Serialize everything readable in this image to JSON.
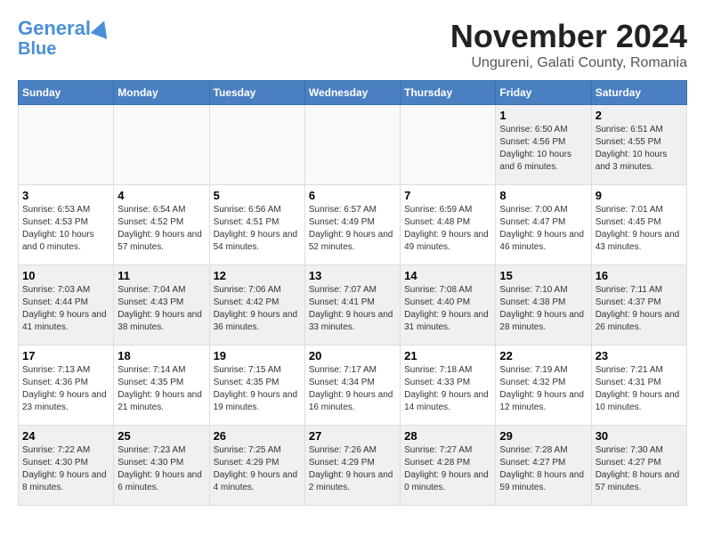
{
  "logo": {
    "line1": "General",
    "line2": "Blue"
  },
  "title": "November 2024",
  "subtitle": "Ungureni, Galati County, Romania",
  "weekdays": [
    "Sunday",
    "Monday",
    "Tuesday",
    "Wednesday",
    "Thursday",
    "Friday",
    "Saturday"
  ],
  "rows": [
    [
      {
        "day": "",
        "info": ""
      },
      {
        "day": "",
        "info": ""
      },
      {
        "day": "",
        "info": ""
      },
      {
        "day": "",
        "info": ""
      },
      {
        "day": "",
        "info": ""
      },
      {
        "day": "1",
        "info": "Sunrise: 6:50 AM\nSunset: 4:56 PM\nDaylight: 10 hours and 6 minutes."
      },
      {
        "day": "2",
        "info": "Sunrise: 6:51 AM\nSunset: 4:55 PM\nDaylight: 10 hours and 3 minutes."
      }
    ],
    [
      {
        "day": "3",
        "info": "Sunrise: 6:53 AM\nSunset: 4:53 PM\nDaylight: 10 hours and 0 minutes."
      },
      {
        "day": "4",
        "info": "Sunrise: 6:54 AM\nSunset: 4:52 PM\nDaylight: 9 hours and 57 minutes."
      },
      {
        "day": "5",
        "info": "Sunrise: 6:56 AM\nSunset: 4:51 PM\nDaylight: 9 hours and 54 minutes."
      },
      {
        "day": "6",
        "info": "Sunrise: 6:57 AM\nSunset: 4:49 PM\nDaylight: 9 hours and 52 minutes."
      },
      {
        "day": "7",
        "info": "Sunrise: 6:59 AM\nSunset: 4:48 PM\nDaylight: 9 hours and 49 minutes."
      },
      {
        "day": "8",
        "info": "Sunrise: 7:00 AM\nSunset: 4:47 PM\nDaylight: 9 hours and 46 minutes."
      },
      {
        "day": "9",
        "info": "Sunrise: 7:01 AM\nSunset: 4:45 PM\nDaylight: 9 hours and 43 minutes."
      }
    ],
    [
      {
        "day": "10",
        "info": "Sunrise: 7:03 AM\nSunset: 4:44 PM\nDaylight: 9 hours and 41 minutes."
      },
      {
        "day": "11",
        "info": "Sunrise: 7:04 AM\nSunset: 4:43 PM\nDaylight: 9 hours and 38 minutes."
      },
      {
        "day": "12",
        "info": "Sunrise: 7:06 AM\nSunset: 4:42 PM\nDaylight: 9 hours and 36 minutes."
      },
      {
        "day": "13",
        "info": "Sunrise: 7:07 AM\nSunset: 4:41 PM\nDaylight: 9 hours and 33 minutes."
      },
      {
        "day": "14",
        "info": "Sunrise: 7:08 AM\nSunset: 4:40 PM\nDaylight: 9 hours and 31 minutes."
      },
      {
        "day": "15",
        "info": "Sunrise: 7:10 AM\nSunset: 4:38 PM\nDaylight: 9 hours and 28 minutes."
      },
      {
        "day": "16",
        "info": "Sunrise: 7:11 AM\nSunset: 4:37 PM\nDaylight: 9 hours and 26 minutes."
      }
    ],
    [
      {
        "day": "17",
        "info": "Sunrise: 7:13 AM\nSunset: 4:36 PM\nDaylight: 9 hours and 23 minutes."
      },
      {
        "day": "18",
        "info": "Sunrise: 7:14 AM\nSunset: 4:35 PM\nDaylight: 9 hours and 21 minutes."
      },
      {
        "day": "19",
        "info": "Sunrise: 7:15 AM\nSunset: 4:35 PM\nDaylight: 9 hours and 19 minutes."
      },
      {
        "day": "20",
        "info": "Sunrise: 7:17 AM\nSunset: 4:34 PM\nDaylight: 9 hours and 16 minutes."
      },
      {
        "day": "21",
        "info": "Sunrise: 7:18 AM\nSunset: 4:33 PM\nDaylight: 9 hours and 14 minutes."
      },
      {
        "day": "22",
        "info": "Sunrise: 7:19 AM\nSunset: 4:32 PM\nDaylight: 9 hours and 12 minutes."
      },
      {
        "day": "23",
        "info": "Sunrise: 7:21 AM\nSunset: 4:31 PM\nDaylight: 9 hours and 10 minutes."
      }
    ],
    [
      {
        "day": "24",
        "info": "Sunrise: 7:22 AM\nSunset: 4:30 PM\nDaylight: 9 hours and 8 minutes."
      },
      {
        "day": "25",
        "info": "Sunrise: 7:23 AM\nSunset: 4:30 PM\nDaylight: 9 hours and 6 minutes."
      },
      {
        "day": "26",
        "info": "Sunrise: 7:25 AM\nSunset: 4:29 PM\nDaylight: 9 hours and 4 minutes."
      },
      {
        "day": "27",
        "info": "Sunrise: 7:26 AM\nSunset: 4:29 PM\nDaylight: 9 hours and 2 minutes."
      },
      {
        "day": "28",
        "info": "Sunrise: 7:27 AM\nSunset: 4:28 PM\nDaylight: 9 hours and 0 minutes."
      },
      {
        "day": "29",
        "info": "Sunrise: 7:28 AM\nSunset: 4:27 PM\nDaylight: 8 hours and 59 minutes."
      },
      {
        "day": "30",
        "info": "Sunrise: 7:30 AM\nSunset: 4:27 PM\nDaylight: 8 hours and 57 minutes."
      }
    ]
  ]
}
